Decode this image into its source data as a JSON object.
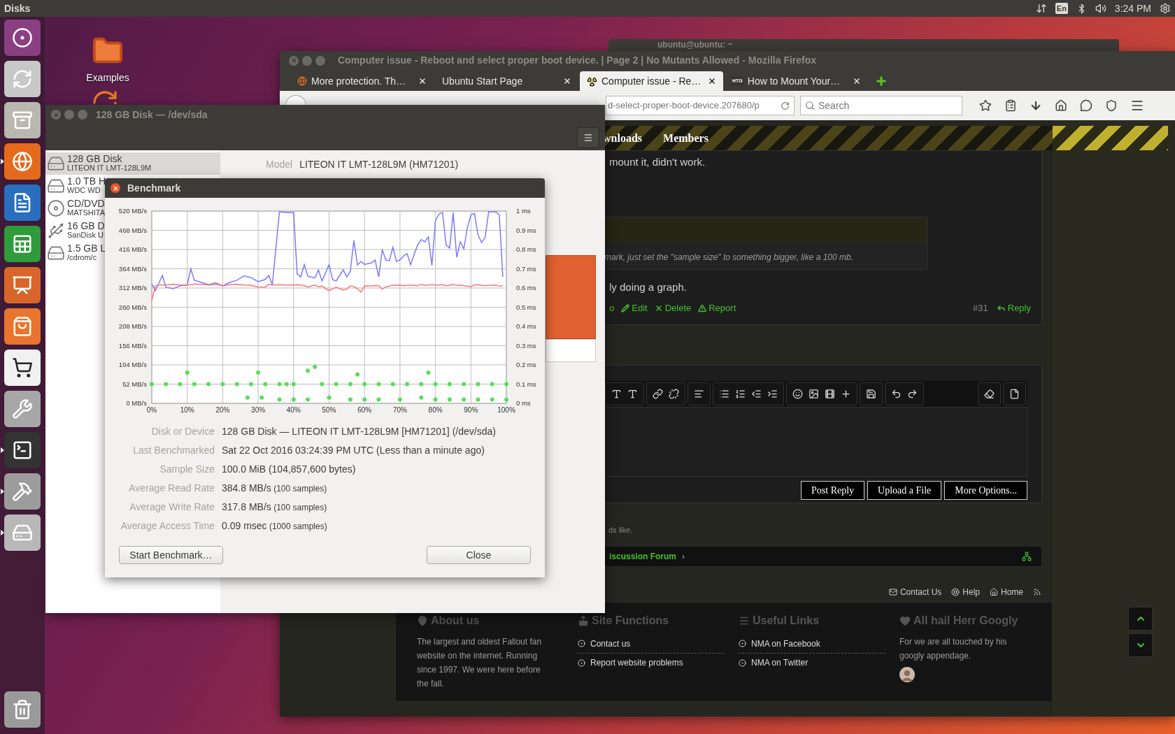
{
  "top_bar": {
    "app_name": "Disks",
    "keyboard": "En",
    "clock": "3:24 PM"
  },
  "launcher": [
    {
      "kind": "dash",
      "running": false
    },
    {
      "kind": "updater",
      "running": false
    },
    {
      "kind": "files",
      "running": false
    },
    {
      "kind": "firefox",
      "running": true
    },
    {
      "kind": "writer",
      "running": false
    },
    {
      "kind": "calc",
      "running": false
    },
    {
      "kind": "impress",
      "running": false
    },
    {
      "kind": "store",
      "running": false
    },
    {
      "kind": "amazon",
      "running": false
    },
    {
      "kind": "settings",
      "running": false
    },
    {
      "kind": "terminal",
      "running": true
    },
    {
      "kind": "utilities",
      "running": true
    },
    {
      "kind": "disks",
      "running": true
    },
    {
      "kind": "trash",
      "running": false
    }
  ],
  "desktop_icons": [
    {
      "label": "Examples"
    }
  ],
  "terminal_window": {
    "title": "ubuntu@ubuntu: ~"
  },
  "firefox": {
    "title": "Computer issue - Reboot and select proper boot device. | Page 2 | No Mutants Allowed - Mozilla Firefox",
    "tabs": [
      {
        "label": "More protection. Th…",
        "selected": false,
        "kind": "firefox"
      },
      {
        "label": "Ubuntu Start Page",
        "selected": false,
        "kind": "none"
      },
      {
        "label": "Computer issue - Re…",
        "selected": true,
        "kind": "radiation"
      },
      {
        "label": "How to Mount Your…",
        "selected": false,
        "kind": "text",
        "favicon_text": "HTG"
      }
    ],
    "url": "d-select-proper-boot-device.207680/p",
    "search": {
      "placeholder": "Search"
    },
    "forum": {
      "nav": [
        "wnloads",
        "Members"
      ],
      "post_lines": [
        "mount it, didn't work.",
        "ly doing a graph."
      ],
      "quote": "mark, just set the \"sample size\" to something bigger, like a 100 mb.",
      "actions": [
        {
          "label": "o",
          "kind": "plain"
        },
        {
          "label": "Edit",
          "kind": "edit"
        },
        {
          "label": "Delete",
          "kind": "delete"
        },
        {
          "label": "Report",
          "kind": "report"
        }
      ],
      "post_number": "#31",
      "reply": "Reply",
      "editor_buttons": [
        "Post Reply",
        "Upload a File",
        "More Options..."
      ],
      "likes_text": "ds like.",
      "breadcrumb": "iscussion Forum",
      "breadcrumb_arrow": "›",
      "footer_links": [
        {
          "label": "Contact Us",
          "kind": "mail"
        },
        {
          "label": "Help",
          "kind": "help"
        },
        {
          "label": "Home",
          "kind": "home"
        },
        {
          "kind": "rss"
        }
      ],
      "footer_columns": [
        {
          "heading": "About us",
          "kind": "text",
          "text": "The largest and oldest Fallout fan website on the internet. Running since 1997. We were here before the fall."
        },
        {
          "heading": "Site Functions",
          "kind": "links",
          "links": [
            "Contact us",
            "Report website problems"
          ]
        },
        {
          "heading": "Useful Links",
          "kind": "links",
          "links": [
            "NMA on Facebook",
            "NMA on Twitter"
          ]
        },
        {
          "heading": "All hail Herr Googly",
          "kind": "text",
          "text": "For we are all touched by his googly appendage.",
          "avatar": true
        }
      ]
    }
  },
  "disks_window": {
    "title": "128 GB Disk — /dev/sda",
    "drives": [
      {
        "name": "128 GB Disk",
        "model": "LITEON IT LMT-128L9M",
        "selected": true,
        "kind": "hdd"
      },
      {
        "name": "1.0 TB H",
        "model": "WDC WD",
        "selected": false,
        "kind": "hdd"
      },
      {
        "name": "CD/DVD",
        "model": "MATSHITA",
        "selected": false,
        "kind": "optical"
      },
      {
        "name": "16 GB D",
        "model": "SanDisk U",
        "selected": false,
        "kind": "usb"
      },
      {
        "name": "1.5 GB L",
        "model": "/cdrom/c",
        "selected": false,
        "kind": "drive"
      }
    ],
    "model_label": "Model",
    "model_value": "LITEON IT LMT-128L9M (HM71201)"
  },
  "benchmark": {
    "title": "Benchmark",
    "chart_data": {
      "type": "line",
      "grid": true,
      "xlim": [
        0,
        100
      ],
      "ylim": [
        0,
        520
      ],
      "xticks": [
        {
          "value": 0,
          "label": "0%"
        },
        {
          "value": 10,
          "label": "10%"
        },
        {
          "value": 20,
          "label": "20%"
        },
        {
          "value": 30,
          "label": "30%"
        },
        {
          "value": 40,
          "label": "40%"
        },
        {
          "value": 50,
          "label": "50%"
        },
        {
          "value": 60,
          "label": "60%"
        },
        {
          "value": 70,
          "label": "70%"
        },
        {
          "value": 80,
          "label": "80%"
        },
        {
          "value": 90,
          "label": "90%"
        },
        {
          "value": 100,
          "label": "100%"
        }
      ],
      "yticks": [
        {
          "value": 0,
          "label": "0 MB/s"
        },
        {
          "value": 52,
          "label": "52 MB/s"
        },
        {
          "value": 104,
          "label": "104 MB/s"
        },
        {
          "value": 156,
          "label": "156 MB/s"
        },
        {
          "value": 208,
          "label": "208 MB/s"
        },
        {
          "value": 260,
          "label": "260 MB/s"
        },
        {
          "value": 312,
          "label": "312 MB/s"
        },
        {
          "value": 364,
          "label": "364 MB/s"
        },
        {
          "value": 416,
          "label": "416 MB/s"
        },
        {
          "value": 468,
          "label": "468 MB/s"
        },
        {
          "value": 520,
          "label": "520 MB/s"
        }
      ],
      "x": [
        0,
        1,
        3,
        4,
        6,
        8,
        10,
        11,
        12,
        14,
        16,
        18,
        20,
        22,
        24,
        26,
        28,
        30,
        32,
        33,
        34,
        36,
        38,
        40,
        41,
        42,
        43,
        44,
        46,
        47,
        48,
        50,
        51,
        52,
        54,
        55,
        56,
        57,
        58,
        59,
        60,
        62,
        63,
        64,
        65,
        66,
        67,
        68,
        69,
        70,
        71,
        72,
        73,
        74,
        75,
        76,
        77,
        78,
        79,
        80,
        81,
        82,
        83,
        84,
        85,
        86,
        87,
        88,
        89,
        90,
        91,
        92,
        93,
        94,
        95,
        97,
        98,
        99
      ],
      "series": [
        {
          "color": "#7b7bff",
          "values": [
            323,
            305,
            346,
            314,
            310,
            318,
            320,
            364,
            333,
            327,
            321,
            326,
            318,
            327,
            333,
            345,
            340,
            329,
            335,
            346,
            321,
            518,
            516,
            516,
            350,
            342,
            375,
            344,
            339,
            361,
            331,
            375,
            335,
            331,
            361,
            342,
            358,
            441,
            374,
            384,
            376,
            380,
            388,
            342,
            416,
            388,
            386,
            422,
            384,
            388,
            399,
            405,
            375,
            403,
            429,
            443,
            437,
            450,
            373,
            494,
            512,
            516,
            429,
            420,
            516,
            395,
            437,
            418,
            475,
            509,
            514,
            456,
            435,
            448,
            518,
            518,
            510,
            342
          ]
        },
        {
          "color": "#ff7474",
          "values": [
            278,
            318,
            321,
            320,
            322,
            320,
            320,
            321,
            323,
            322,
            320,
            322,
            318,
            321,
            322,
            320,
            319,
            315,
            314,
            322,
            320,
            321,
            320,
            320,
            321,
            320,
            318,
            315,
            320,
            316,
            317,
            305,
            310,
            314,
            307,
            309,
            318,
            316,
            310,
            301,
            318,
            317,
            319,
            318,
            309,
            315,
            317,
            320,
            319,
            320,
            318,
            319,
            320,
            319,
            318,
            322,
            319,
            320,
            321,
            320,
            320,
            321,
            318,
            319,
            322,
            319,
            320,
            318,
            317,
            316,
            320,
            321,
            319,
            318,
            319,
            320,
            317,
            318
          ]
        }
      ]
    },
    "access_time_plot": {
      "chart_data": {
        "type": "scatter",
        "xlim": [
          0,
          100
        ],
        "ylim": [
          0,
          1
        ],
        "yticks": [
          {
            "value": 0,
            "label": "0 ms"
          },
          {
            "value": 0.1,
            "label": "0.1 ms"
          },
          {
            "value": 0.2,
            "label": "0.2 ms"
          },
          {
            "value": 0.3,
            "label": "0.3 ms"
          },
          {
            "value": 0.4,
            "label": "0.4 ms"
          },
          {
            "value": 0.5,
            "label": "0.5 ms"
          },
          {
            "value": 0.6,
            "label": "0.6 ms"
          },
          {
            "value": 0.7,
            "label": "0.7 ms"
          },
          {
            "value": 0.8,
            "label": "0.8 ms"
          },
          {
            "value": 0.9,
            "label": "0.9 ms"
          },
          {
            "value": 1,
            "label": "1 ms"
          }
        ],
        "series": [
          {
            "color": "#55e055",
            "x": [
              0,
              4,
              8,
              10,
              12,
              16,
              20,
              24,
              28,
              30,
              32,
              36,
              38,
              40,
              44,
              46,
              48,
              52,
              56,
              58,
              60,
              64,
              68,
              72,
              76,
              78,
              80,
              84,
              88,
              92,
              96,
              100,
              27,
              31,
              36,
              40,
              44,
              50,
              56,
              60,
              64,
              70,
              76,
              80,
              84,
              88,
              92,
              96,
              100
            ],
            "values": [
              0.1,
              0.1,
              0.1,
              0.16,
              0.1,
              0.1,
              0.1,
              0.1,
              0.1,
              0.16,
              0.1,
              0.1,
              0.1,
              0.1,
              0.17,
              0.19,
              0.1,
              0.1,
              0.1,
              0.15,
              0.1,
              0.1,
              0.1,
              0.1,
              0.1,
              0.16,
              0.1,
              0.1,
              0.1,
              0.1,
              0.1,
              0.1,
              0.03,
              0.03,
              0.02,
              0.02,
              0.02,
              0.03,
              0.02,
              0.02,
              0.02,
              0.02,
              0.03,
              0.02,
              0.02,
              0.02,
              0.02,
              0.02,
              0.02
            ]
          }
        ]
      }
    },
    "info": [
      {
        "label": "Disk or Device",
        "value": "128 GB Disk — LITEON IT LMT-128L9M [HM71201] (/dev/sda)"
      },
      {
        "label": "Last Benchmarked",
        "value": "Sat 22 Oct 2016 03:24:39 PM UTC (Less than a minute ago)"
      },
      {
        "label": "Sample Size",
        "value": "100.0 MiB (104,857,600 bytes)"
      },
      {
        "label": "Average Read Rate",
        "value": "384.8 MB/s",
        "note": "(100 samples)"
      },
      {
        "label": "Average Write Rate",
        "value": "317.8 MB/s",
        "note": "(100 samples)"
      },
      {
        "label": "Average Access Time",
        "value": "0.09 msec",
        "note": "(1000 samples)"
      }
    ],
    "buttons": [
      "Start Benchmark…",
      "Close"
    ]
  }
}
